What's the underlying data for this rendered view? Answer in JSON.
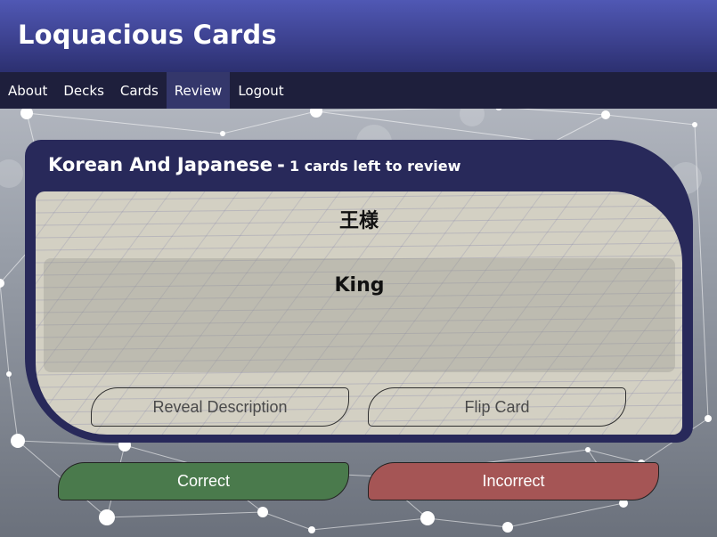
{
  "app": {
    "title": "Loquacious Cards"
  },
  "nav": {
    "items": [
      {
        "label": "About",
        "active": false
      },
      {
        "label": "Decks",
        "active": false
      },
      {
        "label": "Cards",
        "active": false
      },
      {
        "label": "Review",
        "active": true
      },
      {
        "label": "Logout",
        "active": false
      }
    ]
  },
  "review": {
    "deck_name": "Korean And Japanese",
    "separator": "-",
    "cards_left": "1 cards left to review",
    "card": {
      "front": "王様",
      "back": "King"
    },
    "buttons": {
      "reveal": "Reveal Description",
      "flip": "Flip Card",
      "correct": "Correct",
      "incorrect": "Incorrect"
    }
  },
  "colors": {
    "header": "#3d4290",
    "nav": "#1e1f3c",
    "nav_active": "#34376b",
    "panel": "#28295a",
    "correct": "#4a7a4c",
    "incorrect": "#a55555"
  }
}
